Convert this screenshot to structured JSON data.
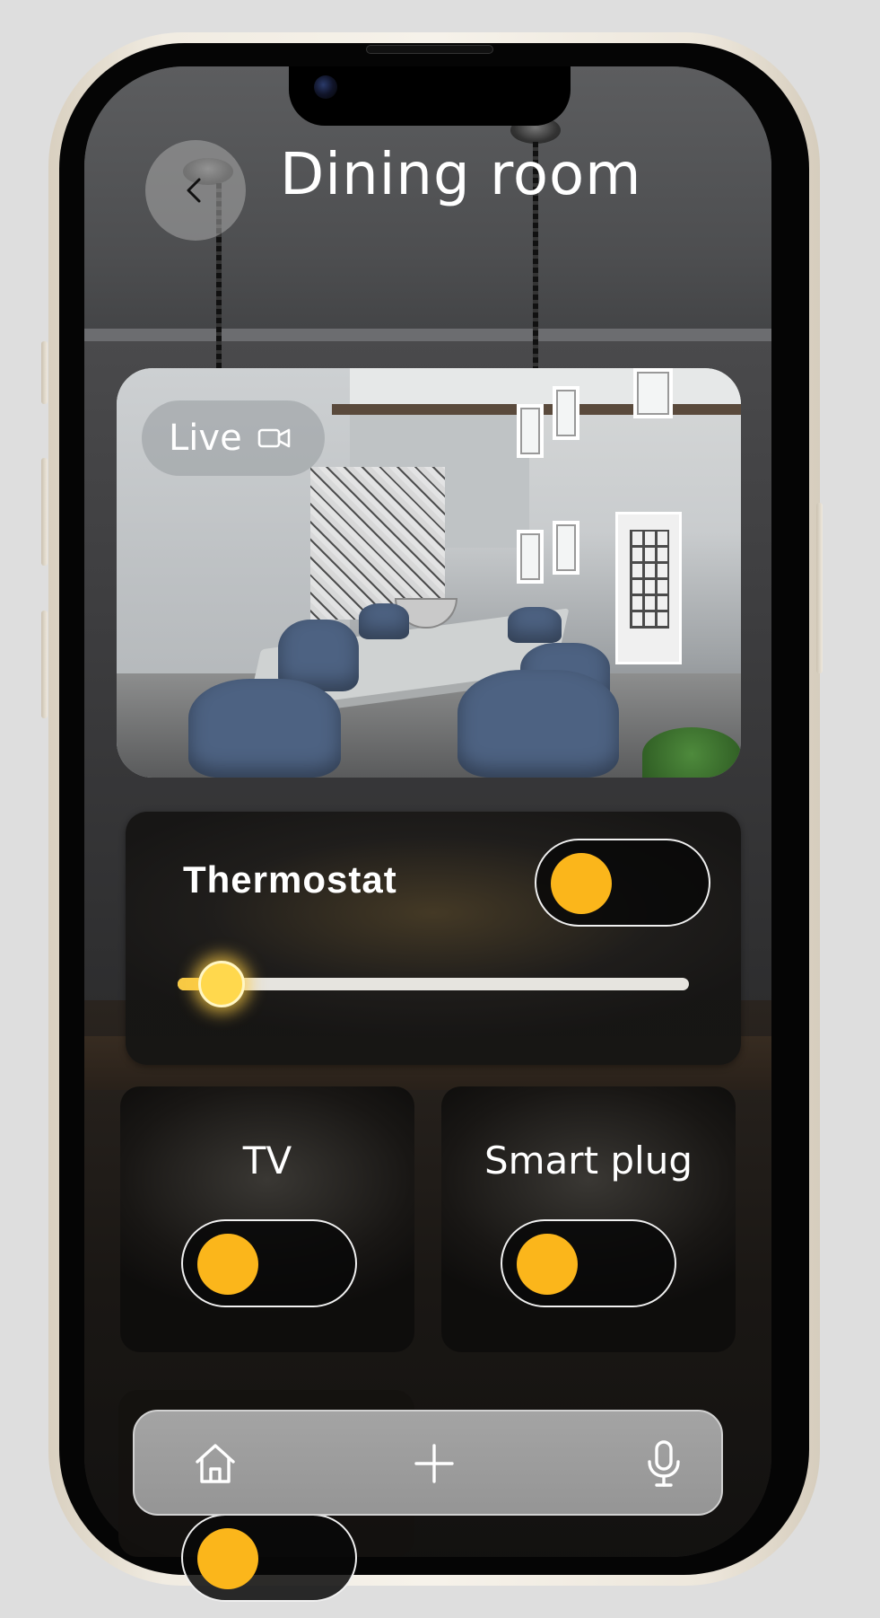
{
  "header": {
    "title": "Dining room",
    "back_icon": "chevron-left-icon"
  },
  "camera": {
    "live_label": "Live",
    "live_icon": "video-camera-icon"
  },
  "thermostat": {
    "label": "Thermostat",
    "toggle_on": true,
    "slider_level_percent": 5
  },
  "devices": [
    {
      "label": "TV",
      "toggle_on": true
    },
    {
      "label": "Smart plug",
      "toggle_on": true
    }
  ],
  "navbar": {
    "items": [
      {
        "icon": "home-icon"
      },
      {
        "icon": "plus-icon"
      },
      {
        "icon": "microphone-icon"
      }
    ]
  },
  "colors": {
    "accent": "#fbb61b",
    "text": "#ffffff"
  }
}
